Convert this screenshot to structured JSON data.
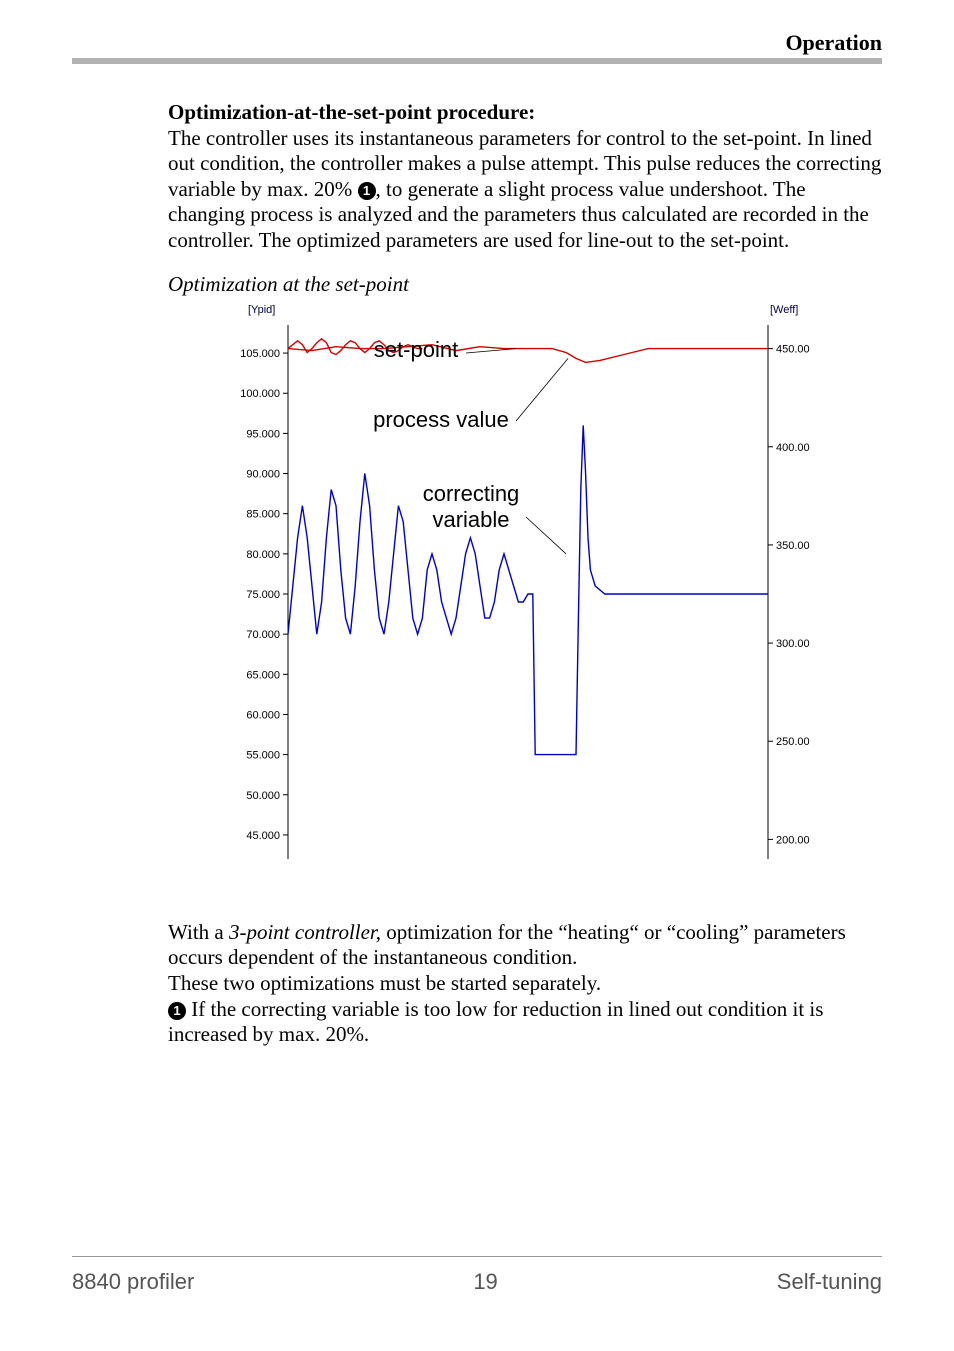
{
  "header": {
    "section": "Operation"
  },
  "body": {
    "heading": "Optimization-at-the-set-point procedure:",
    "para1a": "The controller uses its instantaneous parameters for control to the set-point. In lined out condition, the controller makes a pulse attempt. This pulse reduces the correcting variable by max. 20% ",
    "para1b": ", to generate a slight process value undershoot. The changing process is analyzed and the parameters thus calculated are recorded in the controller. The optimized parameters are used for line-out to the set-point.",
    "fig_caption": "Optimization at the set-point",
    "para2a": "With a ",
    "para2b": "3-point controller,",
    "para2c": " optimization for the “heating“ or “cooling” parameters occurs dependent of the instantaneous condition.",
    "para3": "These two optimizations must be started separately.",
    "note1": "  If the correcting variable is too low for reduction in lined out condition it is increased by max. 20%."
  },
  "circled_1": "1",
  "footer": {
    "left": "8840 profiler",
    "center": "19",
    "right": "Self-tuning"
  },
  "chart_data": {
    "type": "line",
    "left_axis_label": "[Ypid]",
    "right_axis_label": "[Weff]",
    "annotations": {
      "set_point": "set-point",
      "process_value": "process value",
      "correcting_variable": "correcting\nvariable"
    },
    "y_left_ticks": [
      45.0,
      50.0,
      55.0,
      60.0,
      65.0,
      70.0,
      75.0,
      80.0,
      85.0,
      90.0,
      95.0,
      100.0,
      105.0
    ],
    "y_right_ticks": [
      200.0,
      250.0,
      300.0,
      350.0,
      400.0,
      450.0
    ],
    "y_left_range": [
      42,
      108
    ],
    "y_right_range": [
      190,
      460
    ],
    "series": [
      {
        "name": "set-point",
        "color": "#d40000",
        "axis": "right",
        "x": [
          0,
          5,
          10,
          15,
          20,
          25,
          30,
          35,
          40,
          45,
          50,
          55,
          58,
          60,
          62,
          65,
          70,
          75,
          80,
          85,
          90,
          95,
          100
        ],
        "y": [
          450,
          449,
          451,
          450,
          450,
          451,
          452,
          449,
          451,
          450,
          450,
          450,
          448,
          445,
          443,
          444,
          447,
          450,
          450,
          450,
          450,
          450,
          450
        ]
      },
      {
        "name": "process value (oscillation)",
        "color": "#d40000",
        "axis": "right",
        "x": [
          0,
          1,
          2,
          3,
          4,
          5,
          6,
          7,
          8,
          9,
          10,
          11,
          12,
          13,
          14,
          15,
          16,
          17,
          18,
          19,
          20,
          21,
          22,
          23,
          24,
          25,
          26,
          27,
          28
        ],
        "y": [
          450,
          452,
          454,
          452,
          448,
          450,
          453,
          455,
          453,
          448,
          447,
          449,
          452,
          454,
          453,
          450,
          448,
          450,
          453,
          454,
          452,
          449,
          448,
          449,
          451,
          452,
          451,
          450,
          450
        ]
      },
      {
        "name": "correcting variable",
        "color": "#0000c8",
        "axis": "left",
        "x": [
          0,
          1,
          2,
          3,
          4,
          5,
          6,
          7,
          8,
          9,
          10,
          11,
          12,
          13,
          14,
          15,
          16,
          17,
          18,
          19,
          20,
          21,
          22,
          23,
          24,
          25,
          26,
          27,
          28,
          29,
          30,
          31,
          32,
          33,
          34,
          35,
          36,
          37,
          38,
          39,
          40,
          41,
          42,
          43,
          44,
          45,
          46,
          47,
          48,
          49,
          50,
          51,
          51.5,
          52,
          55,
          58,
          60,
          60.5,
          61,
          61.5,
          62,
          62.5,
          63,
          64,
          66,
          70,
          75,
          80,
          85,
          90,
          95,
          100
        ],
        "y": [
          70,
          76,
          82,
          86,
          82,
          76,
          70,
          74,
          82,
          88,
          86,
          78,
          72,
          70,
          76,
          84,
          90,
          86,
          78,
          72,
          70,
          74,
          80,
          86,
          84,
          78,
          72,
          70,
          72,
          78,
          80,
          78,
          74,
          72,
          70,
          72,
          76,
          80,
          82,
          80,
          76,
          72,
          72,
          74,
          78,
          80,
          78,
          76,
          74,
          74,
          75,
          75,
          55,
          55,
          55,
          55,
          55,
          72,
          88,
          96,
          90,
          82,
          78,
          76,
          75,
          75,
          75,
          75,
          75,
          75,
          75,
          75
        ]
      }
    ]
  }
}
